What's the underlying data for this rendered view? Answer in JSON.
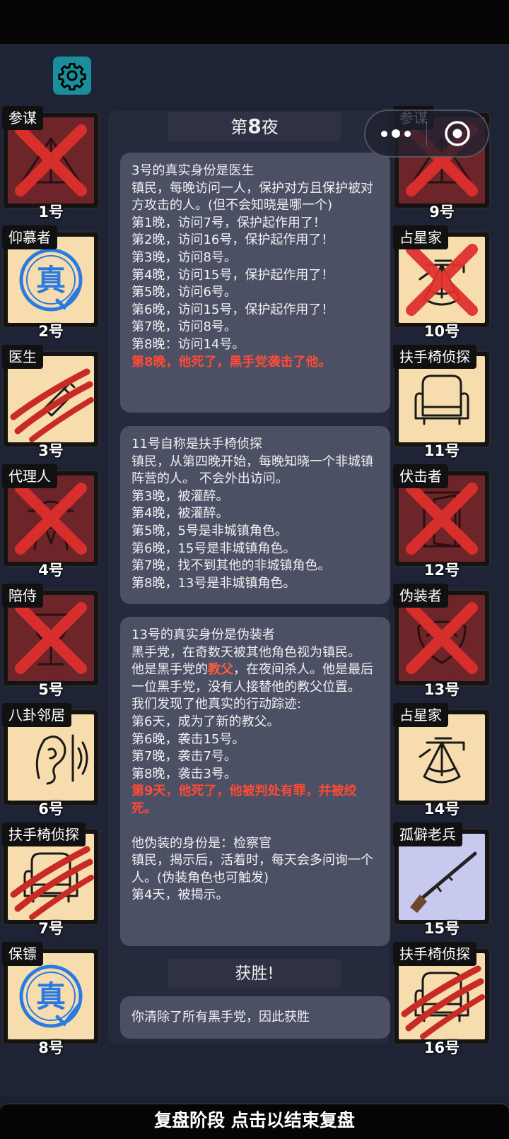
{
  "header_bar": {},
  "settings_icon": "gear-icon",
  "capsule": {
    "more_icon": "more-dots-icon",
    "close_icon": "target-close-icon"
  },
  "cards_left": [
    {
      "role": "参谋",
      "num": "1号",
      "state": "dead",
      "art": "tent"
    },
    {
      "role": "仰慕者",
      "num": "2号",
      "state": "alive",
      "art": "true-stamp"
    },
    {
      "role": "医生",
      "num": "3号",
      "state": "slashed",
      "art": "syringe"
    },
    {
      "role": "代理人",
      "num": "4号",
      "state": "dead",
      "art": "agent"
    },
    {
      "role": "陪侍",
      "num": "5号",
      "state": "dead",
      "art": "glass"
    },
    {
      "role": "八卦邻居",
      "num": "6号",
      "state": "alive",
      "art": "ear"
    },
    {
      "role": "扶手椅侦探",
      "num": "7号",
      "state": "slashed",
      "art": "armchair"
    },
    {
      "role": "保镖",
      "num": "8号",
      "state": "alive",
      "art": "true-stamp"
    }
  ],
  "cards_right": [
    {
      "role": "参谋",
      "num": "9号",
      "state": "dead",
      "art": "tent"
    },
    {
      "role": "占星家",
      "num": "10号",
      "state": "crossed",
      "art": "sextant"
    },
    {
      "role": "扶手椅侦探",
      "num": "11号",
      "state": "alive",
      "art": "armchair"
    },
    {
      "role": "伏击者",
      "num": "12号",
      "state": "dead",
      "art": "door"
    },
    {
      "role": "伪装者",
      "num": "13号",
      "state": "dead",
      "art": "mask"
    },
    {
      "role": "占星家",
      "num": "14号",
      "state": "alive",
      "art": "sextant"
    },
    {
      "role": "孤僻老兵",
      "num": "15号",
      "state": "lav",
      "art": "rifle"
    },
    {
      "role": "扶手椅侦探",
      "num": "16号",
      "state": "slashed",
      "art": "armchair"
    }
  ],
  "night_header": {
    "prefix": "第",
    "num": "8",
    "suffix": "夜"
  },
  "box1": {
    "lines": [
      "3号的真实身份是医生",
      "镇民，每晚访问一人，保护对方且保护被对方攻击的人。(但不会知晓是哪一个)",
      "第1晚，访问7号，保护起作用了！",
      "第2晚，访问16号，保护起作用了！",
      "第3晚，访问8号。",
      "第4晚，访问15号，保护起作用了！",
      "第5晚，访问6号。",
      "第6晚，访问15号，保护起作用了！",
      "第7晚，访问8号。",
      "第8晚：访问14号。"
    ],
    "death": "第8晚，他死了，黑手党袭击了他。"
  },
  "box2": {
    "lines": [
      "11号自称是扶手椅侦探",
      "镇民，从第四晚开始，每晚知晓一个非城镇阵营的人。 不会外出访问。",
      "第3晚，被灌醉。",
      "第4晚，被灌醉。",
      "第5晚，5号是非城镇角色。",
      "第6晚，15号是非城镇角色。",
      "第7晚，找不到其他的非城镇角色。",
      "第8晚，13号是非城镇角色。"
    ]
  },
  "box3": {
    "line1": "13号的真实身份是伪装者",
    "line2": "黑手党，在奇数天被其他角色视为镇民。",
    "line3_pre": "他是黑手党的",
    "line3_hl": "教父",
    "line3_post": "，在夜间杀人。他是最后一位黑手党，没有人接替他的教父位置。",
    "lines": [
      "我们发现了他真实的行动踪迹:",
      "第6天，成为了新的教父。",
      "第6晚，袭击15号。",
      "第7晚，袭击7号。",
      "第8晚，袭击3号。"
    ],
    "death": "第9天，他死了，他被判处有罪，并被绞死。",
    "disguise_lines": [
      "他伪装的身份是：检察官",
      "镇民，揭示后，活着时，每天会多问询一个人。(伪装角色也可触发)",
      "第4天，被揭示。"
    ]
  },
  "victory_header": "获胜!",
  "victory_text": "你清除了所有黑手党，因此获胜",
  "bottom_bar": "复盘阶段 点击以结束复盘",
  "colors": {
    "dead_bg": "#6d2529",
    "alive_bg": "#f7dcae",
    "cross": "#e0302d",
    "accent_red": "#ff4a36",
    "true_stamp": "#2a7be0"
  }
}
